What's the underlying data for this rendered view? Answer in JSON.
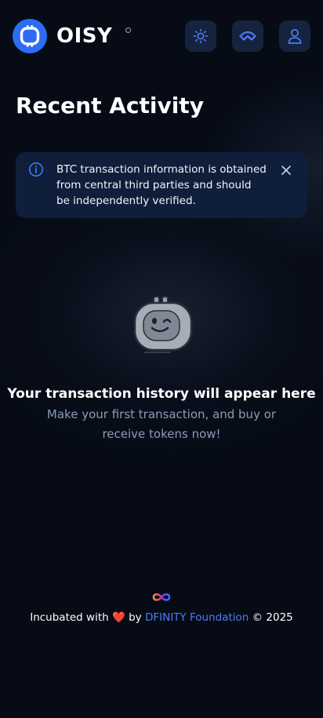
{
  "header": {
    "brand_name": "OISY",
    "icons": [
      "oisy-logo-icon",
      "sun-icon",
      "walletconnect-icon",
      "user-icon"
    ]
  },
  "page": {
    "title": "Recent Activity"
  },
  "alert": {
    "message": "BTC transaction information is obtained from central third parties and should be independently verified."
  },
  "empty_state": {
    "title": "Your transaction history will appear here",
    "subtitle": "Make your first transaction, and buy or receive tokens now!"
  },
  "footer": {
    "prefix": "Incubated with",
    "heart": "❤️",
    "by": "by",
    "link": "DFINITY Foundation",
    "suffix": "© 2025"
  },
  "colors": {
    "background": "#060b16",
    "accent": "#2c6cf6",
    "alert_bg": "#0f1e3a",
    "button_bg": "#15233f",
    "link": "#4d7ef5"
  }
}
